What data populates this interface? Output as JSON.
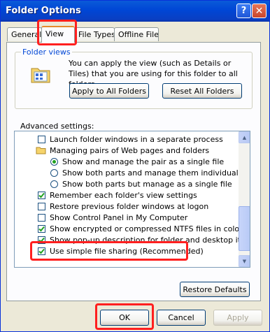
{
  "window": {
    "title": "Folder Options",
    "help_glyph": "?",
    "close_glyph": "✕"
  },
  "tabs": [
    {
      "label": "General",
      "active": false
    },
    {
      "label": "View",
      "active": true
    },
    {
      "label": "File Types",
      "active": false
    },
    {
      "label": "Offline Files",
      "active": false
    }
  ],
  "folder_views": {
    "label": "Folder views",
    "description": "You can apply the view (such as Details or Tiles) that you are using for this folder to all folders.",
    "apply_button": "Apply to All Folders",
    "reset_button": "Reset All Folders"
  },
  "advanced": {
    "label": "Advanced settings:",
    "items": [
      {
        "kind": "checkbox",
        "label": "Launch folder windows in a separate process",
        "checked": false
      },
      {
        "kind": "folder",
        "label": "Managing pairs of Web pages and folders"
      },
      {
        "kind": "radio",
        "label": "Show and manage the pair as a single file",
        "checked": true
      },
      {
        "kind": "radio",
        "label": "Show both parts and manage them individually",
        "checked": false
      },
      {
        "kind": "radio",
        "label": "Show both parts but manage as a single file",
        "checked": false
      },
      {
        "kind": "checkbox",
        "label": "Remember each folder's view settings",
        "checked": true
      },
      {
        "kind": "checkbox",
        "label": "Restore previous folder windows at logon",
        "checked": false
      },
      {
        "kind": "checkbox",
        "label": "Show Control Panel in My Computer",
        "checked": false
      },
      {
        "kind": "checkbox",
        "label": "Show encrypted or compressed NTFS files in color",
        "checked": true
      },
      {
        "kind": "checkbox",
        "label": "Show pop-up description for folder and desktop items",
        "checked": true
      },
      {
        "kind": "checkbox",
        "label": "Use simple file sharing (Recommended)",
        "checked": true
      }
    ],
    "restore_button": "Restore Defaults"
  },
  "dialog_buttons": {
    "ok": "OK",
    "cancel": "Cancel",
    "apply": "Apply"
  },
  "colors": {
    "highlight": "#ff1f1f",
    "titlebar": "#0046d5",
    "check": "#21a121"
  }
}
